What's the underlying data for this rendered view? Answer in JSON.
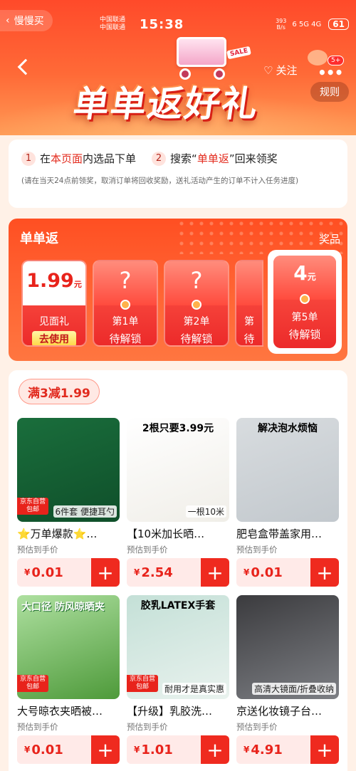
{
  "top": {
    "back_app_label": "慢慢买",
    "carrier_1": "中国联通",
    "carrier_2": "中国联通",
    "time": "15:38",
    "net_speed": "393",
    "net_unit": "B/s",
    "signal_text": "6 5G 4G",
    "battery": "61"
  },
  "header": {
    "follow_label": "关注",
    "badge": "5+",
    "rules_label": "规则",
    "title": "单单返好礼",
    "sale_tag": "SALE"
  },
  "steps": {
    "step1_num": "1",
    "step1_pre": "在",
    "step1_highlight": "本页面",
    "step1_post": "内选品下单",
    "step2_num": "2",
    "step2_pre": "搜索“",
    "step2_highlight": "单单返",
    "step2_post": "”回来领奖",
    "note": "(请在当天24点前领奖，取消订单将回收奖励，送礼活动产生的订单不计入任务进度)"
  },
  "rewards": {
    "title": "单单返",
    "prize_label": "奖品",
    "cards": [
      {
        "price": "1.99",
        "unit": "元",
        "line1": "见面礼",
        "action": "去使用"
      },
      {
        "symbol": "?",
        "line1": "第1单",
        "line2": "待解锁"
      },
      {
        "symbol": "?",
        "line1": "第2单",
        "line2": "待解锁"
      },
      {
        "line1": "第",
        "line2": "待"
      }
    ],
    "final": {
      "amount": "4",
      "unit": "元",
      "line1": "第5单",
      "line2": "待解锁"
    }
  },
  "products": {
    "promo_tag": "满3减1.99",
    "self_tag_1": "京东自营",
    "self_tag_2": "包邮",
    "items": [
      {
        "title": "⭐万单爆款⭐…",
        "estimate_label": "预估到手价",
        "currency": "¥",
        "price": "0.01",
        "caption": "6件套 便捷耳勺",
        "img_top": ""
      },
      {
        "title": "【10米加长晒…",
        "estimate_label": "预估到手价",
        "currency": "¥",
        "price": "2.54",
        "caption": "一根10米",
        "img_top": "2根只要3.99元"
      },
      {
        "title": "肥皂盒带盖家用…",
        "estimate_label": "预估到手价",
        "currency": "¥",
        "price": "0.01",
        "caption": "",
        "img_top": "解决泡水烦恼"
      },
      {
        "title": "大号晾衣夹晒被…",
        "estimate_label": "预估到手价",
        "currency": "¥",
        "price": "0.01",
        "caption": "",
        "img_top": "大口径 防风晾晒夹"
      },
      {
        "title": "【升级】乳胶洗…",
        "estimate_label": "预估到手价",
        "currency": "¥",
        "price": "1.01",
        "caption": "耐用才是真实惠",
        "img_top": "胶乳LATEX手套"
      },
      {
        "title": "京送化妆镜子台…",
        "estimate_label": "预估到手价",
        "currency": "¥",
        "price": "4.91",
        "caption": "高清大镜面/折叠收纳",
        "img_top": ""
      }
    ]
  }
}
